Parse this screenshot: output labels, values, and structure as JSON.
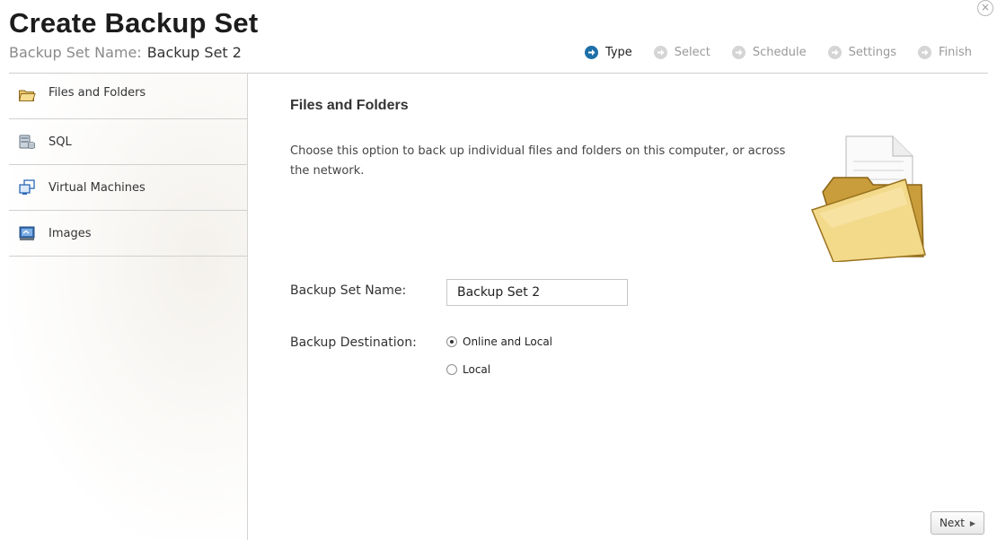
{
  "window": {
    "title": "Create Backup Set",
    "subtitle_label": "Backup Set Name:",
    "subtitle_value": "Backup Set 2",
    "close_label": "×"
  },
  "steps": [
    {
      "label": "Type",
      "active": true
    },
    {
      "label": "Select",
      "active": false
    },
    {
      "label": "Schedule",
      "active": false
    },
    {
      "label": "Settings",
      "active": false
    },
    {
      "label": "Finish",
      "active": false
    }
  ],
  "sidebar": {
    "items": [
      {
        "label": "Files and Folders",
        "icon": "folder-icon"
      },
      {
        "label": "SQL",
        "icon": "database-icon"
      },
      {
        "label": "Virtual Machines",
        "icon": "virtual-machines-icon"
      },
      {
        "label": "Images",
        "icon": "image-backup-icon"
      }
    ]
  },
  "main": {
    "heading": "Files and Folders",
    "description": "Choose this option to back up individual files and folders on this computer, or across the network.",
    "name_label": "Backup Set Name:",
    "name_value": "Backup Set 2",
    "destination_label": "Backup Destination:",
    "destination_options": [
      {
        "label": "Online and Local",
        "selected": true
      },
      {
        "label": "Local",
        "selected": false
      }
    ]
  },
  "footer": {
    "next_label": "Next",
    "next_arrow": "▶"
  },
  "colors": {
    "accent": "#1e6fa8",
    "inactive_step": "#d5d5d5"
  }
}
